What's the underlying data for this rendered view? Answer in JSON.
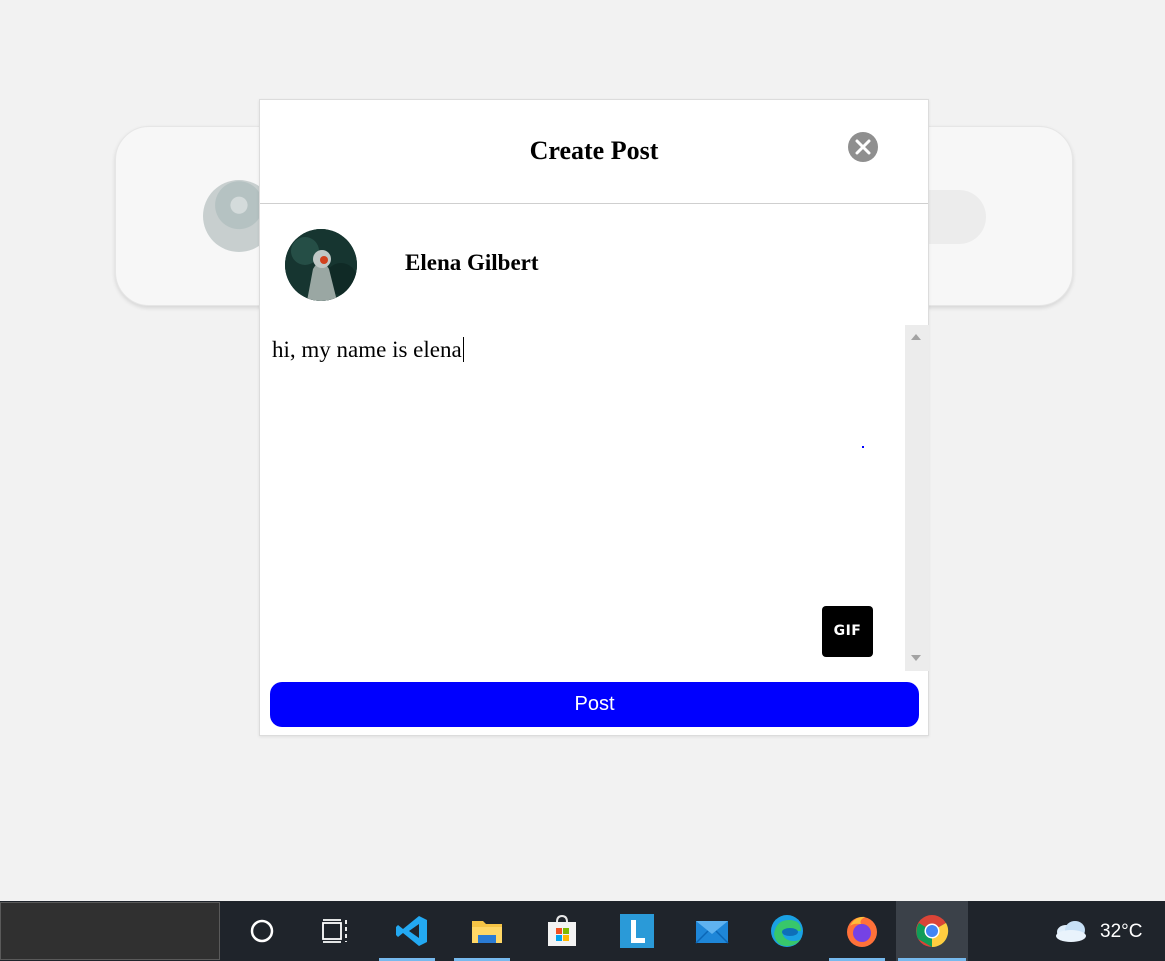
{
  "modal": {
    "title": "Create Post",
    "user_name": "Elena Gilbert",
    "post_text": "hi, my name is elena",
    "gif_label": "GIF",
    "post_button": "Post"
  },
  "taskbar": {
    "temperature": "32°C",
    "apps": [
      {
        "name": "cortana-icon"
      },
      {
        "name": "task-view-icon"
      },
      {
        "name": "vscode-icon"
      },
      {
        "name": "file-explorer-icon"
      },
      {
        "name": "microsoft-store-icon"
      },
      {
        "name": "lightshot-icon"
      },
      {
        "name": "mail-icon"
      },
      {
        "name": "edge-icon"
      },
      {
        "name": "firefox-icon"
      },
      {
        "name": "chrome-icon"
      }
    ]
  },
  "colors": {
    "accent": "#0000ff",
    "close_button": "#8f8f8f",
    "taskbar": "#1f242b"
  }
}
